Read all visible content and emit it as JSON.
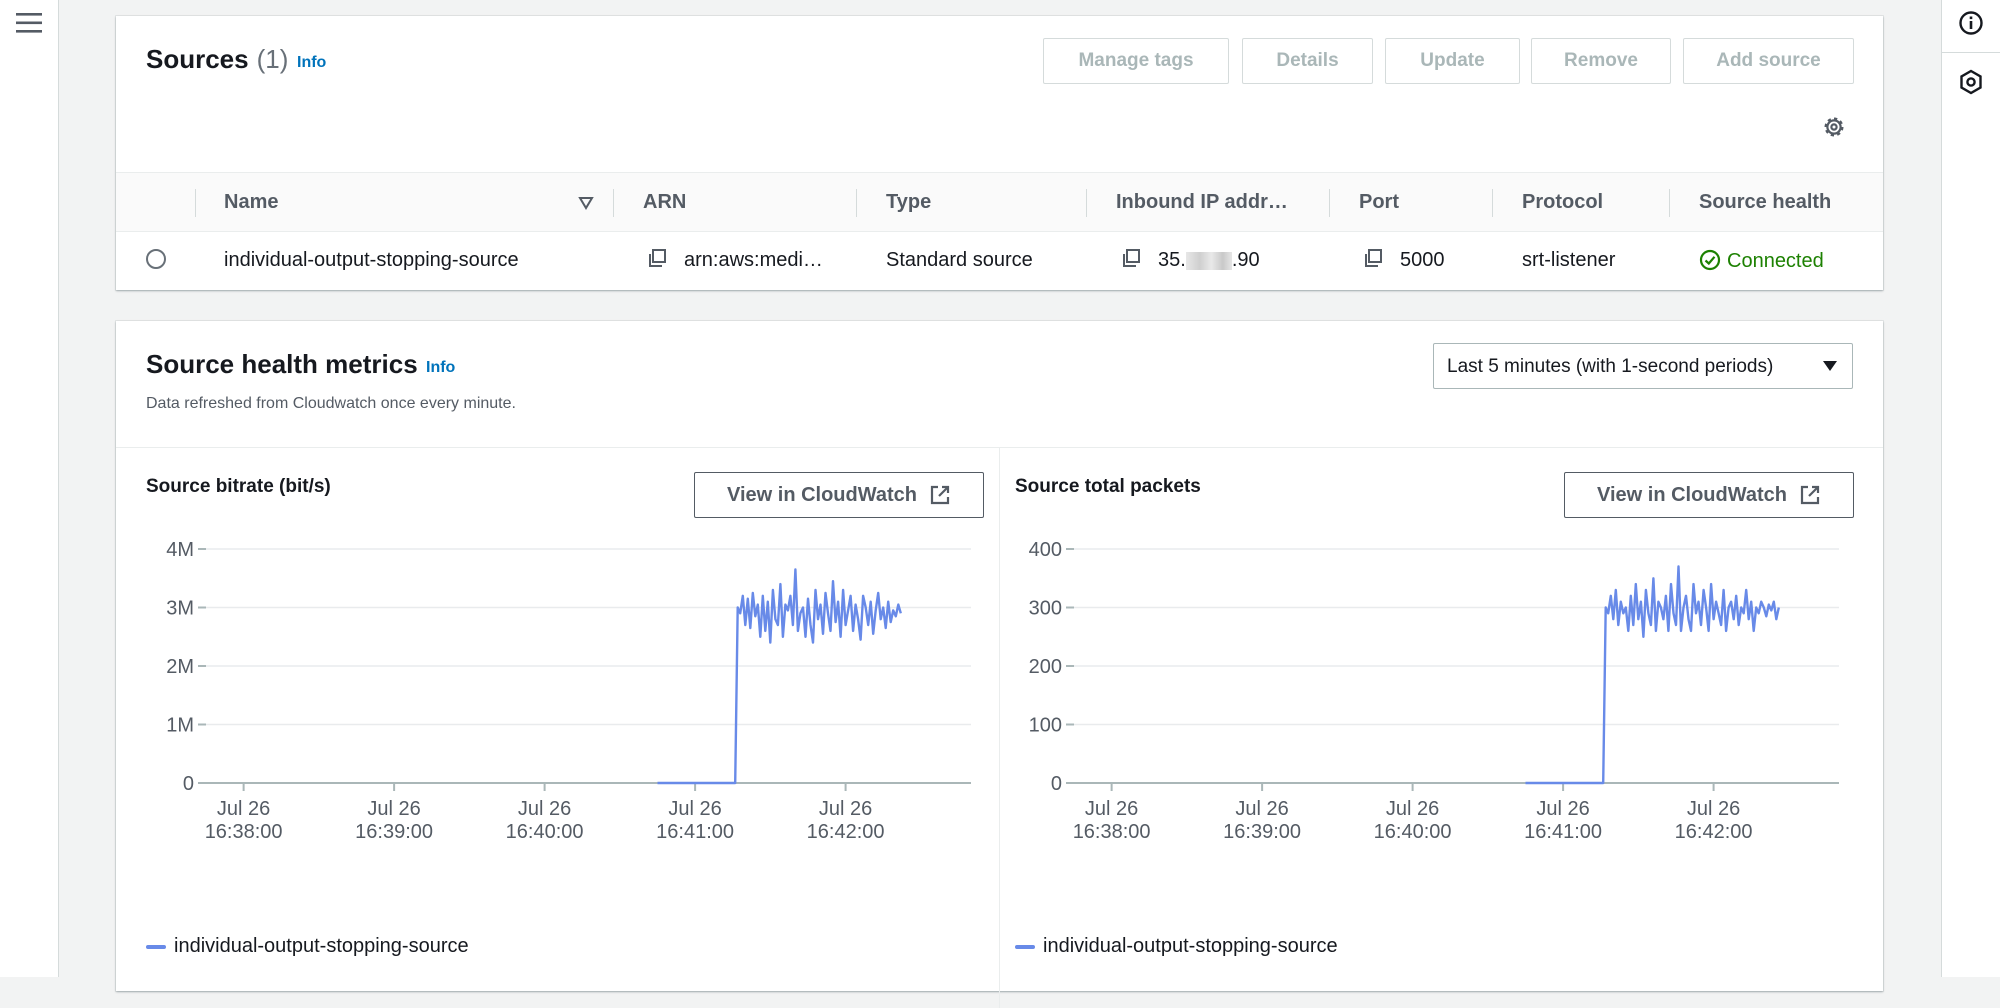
{
  "sources": {
    "title": "Sources",
    "count": "(1)",
    "info": "Info",
    "buttons": [
      "Manage tags",
      "Details",
      "Update",
      "Remove",
      "Add source"
    ],
    "columns": [
      "Name",
      "ARN",
      "Type",
      "Inbound IP addr…",
      "Port",
      "Protocol",
      "Source health"
    ],
    "rows": [
      {
        "name": "individual-output-stopping-source",
        "arn": "arn:aws:medi…",
        "type": "Standard source",
        "ip_prefix": "35.",
        "ip_suffix": ".90",
        "port": "5000",
        "protocol": "srt-listener",
        "health": "Connected"
      }
    ]
  },
  "metrics": {
    "title": "Source health metrics",
    "info": "Info",
    "subtitle": "Data refreshed from Cloudwatch once every minute.",
    "range_label": "Last 5 minutes (with 1-second periods)",
    "view_button": "View in CloudWatch"
  },
  "colors": {
    "series": "#688ae8",
    "link": "#0073bb",
    "success": "#1d8102"
  },
  "chart_data": [
    {
      "type": "line",
      "title": "Source bitrate (bit/s)",
      "y_ticks": [
        "0",
        "1M",
        "2M",
        "3M",
        "4M"
      ],
      "ylim": [
        0,
        4000000
      ],
      "x_ticks": [
        [
          "Jul 26",
          "16:38:00"
        ],
        [
          "Jul 26",
          "16:39:00"
        ],
        [
          "Jul 26",
          "16:40:00"
        ],
        [
          "Jul 26",
          "16:41:00"
        ],
        [
          "Jul 26",
          "16:42:00"
        ]
      ],
      "grid": true,
      "series": [
        {
          "name": "individual-output-stopping-source",
          "x_start": "16:40:45",
          "x_end": "16:42:30",
          "step_seconds": 1,
          "values": [
            0,
            0,
            0,
            0,
            0,
            0,
            0,
            0,
            0,
            0,
            0,
            0,
            0,
            0,
            0,
            0,
            0,
            0,
            0,
            0,
            0,
            0,
            0,
            0,
            0,
            0,
            0,
            0,
            0,
            0,
            0,
            0,
            3000000,
            2900000,
            3200000,
            2700000,
            3150000,
            2650000,
            3250000,
            2850000,
            3050000,
            2500000,
            3200000,
            2600000,
            3100000,
            2400000,
            3300000,
            2800000,
            2700000,
            3400000,
            2500000,
            3050000,
            2950000,
            3200000,
            2700000,
            3650000,
            2600000,
            2900000,
            3000000,
            2500000,
            3150000,
            2700000,
            2400000,
            3300000,
            2800000,
            3050000,
            2550000,
            3250000,
            2900000,
            2600000,
            3450000,
            2750000,
            3100000,
            2500000,
            3300000,
            2700000,
            2950000,
            3200000,
            2600000,
            3050000,
            2800000,
            2450000,
            3200000,
            3000000,
            2700000,
            3100000,
            2550000,
            2950000,
            3250000,
            2800000,
            3000000,
            2650000,
            3100000,
            2750000,
            2950000,
            2850000,
            3050000,
            2900000
          ]
        }
      ]
    },
    {
      "type": "line",
      "title": "Source total packets",
      "y_ticks": [
        "0",
        "100",
        "200",
        "300",
        "400"
      ],
      "ylim": [
        0,
        400
      ],
      "x_ticks": [
        [
          "Jul 26",
          "16:38:00"
        ],
        [
          "Jul 26",
          "16:39:00"
        ],
        [
          "Jul 26",
          "16:40:00"
        ],
        [
          "Jul 26",
          "16:41:00"
        ],
        [
          "Jul 26",
          "16:42:00"
        ]
      ],
      "grid": true,
      "series": [
        {
          "name": "individual-output-stopping-source",
          "x_start": "16:40:45",
          "x_end": "16:42:30",
          "step_seconds": 1,
          "values": [
            0,
            0,
            0,
            0,
            0,
            0,
            0,
            0,
            0,
            0,
            0,
            0,
            0,
            0,
            0,
            0,
            0,
            0,
            0,
            0,
            0,
            0,
            0,
            0,
            0,
            0,
            0,
            0,
            0,
            0,
            0,
            0,
            300,
            290,
            320,
            280,
            330,
            270,
            310,
            290,
            300,
            260,
            320,
            270,
            340,
            280,
            310,
            250,
            330,
            290,
            270,
            350,
            260,
            310,
            300,
            280,
            320,
            260,
            340,
            290,
            270,
            370,
            260,
            300,
            320,
            280,
            260,
            340,
            290,
            310,
            270,
            330,
            300,
            260,
            340,
            280,
            310,
            290,
            270,
            330,
            260,
            300,
            310,
            280,
            320,
            270,
            300,
            290,
            330,
            280,
            310,
            260,
            300,
            290,
            310,
            300,
            285,
            305,
            295,
            310,
            280,
            300
          ]
        }
      ]
    }
  ]
}
